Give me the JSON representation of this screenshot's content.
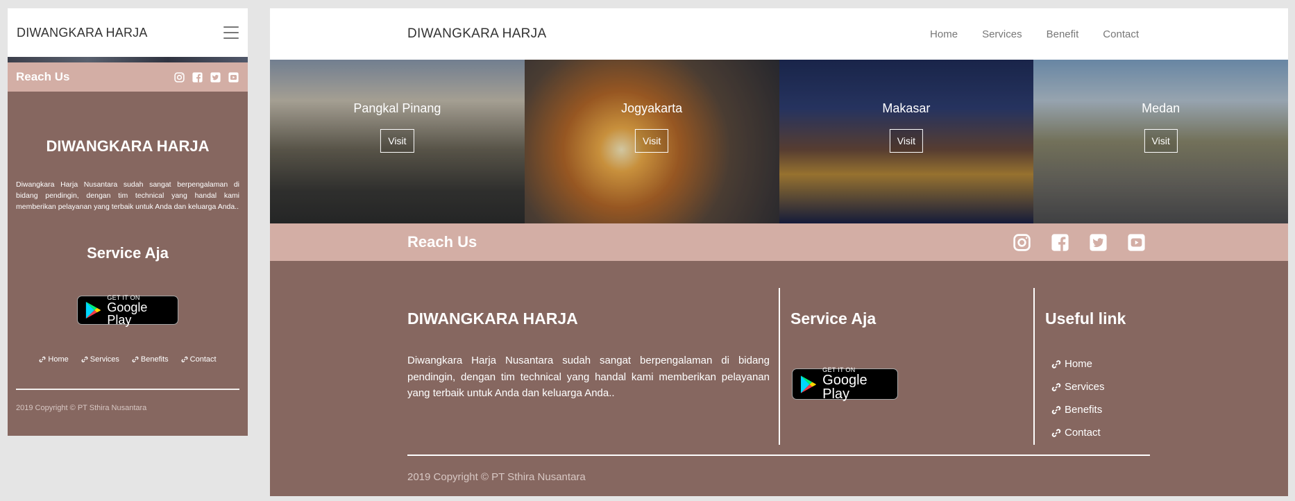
{
  "brand": "DIWANGKARA HARJA",
  "nav": {
    "items": [
      "Home",
      "Services",
      "Benefit",
      "Contact"
    ]
  },
  "cities": [
    {
      "name": "Pangkal Pinang",
      "button": "Visit"
    },
    {
      "name": "Jogyakarta",
      "button": "Visit"
    },
    {
      "name": "Makasar",
      "button": "Visit"
    },
    {
      "name": "Medan",
      "button": "Visit"
    }
  ],
  "reach": {
    "title": "Reach Us",
    "icons": [
      "instagram-icon",
      "facebook-icon",
      "twitter-icon",
      "youtube-icon"
    ]
  },
  "footer": {
    "brand": "DIWANGKARA HARJA",
    "description": "Diwangkara Harja Nusantara sudah sangat berpengalaman di bidang pendingin, dengan tim technical yang handal kami memberikan pelayanan yang terbaik untuk Anda dan keluarga Anda..",
    "service_title": "Service Aja",
    "google_play": {
      "small": "GET IT ON",
      "big": "Google Play"
    },
    "useful_title": "Useful link",
    "links": [
      "Home",
      "Services",
      "Benefits",
      "Contact"
    ],
    "copyright": "2019 Copyright © PT Sthira Nusantara"
  },
  "colors": {
    "reach_bg": "#d3aea5",
    "footer_bg": "#866760"
  }
}
